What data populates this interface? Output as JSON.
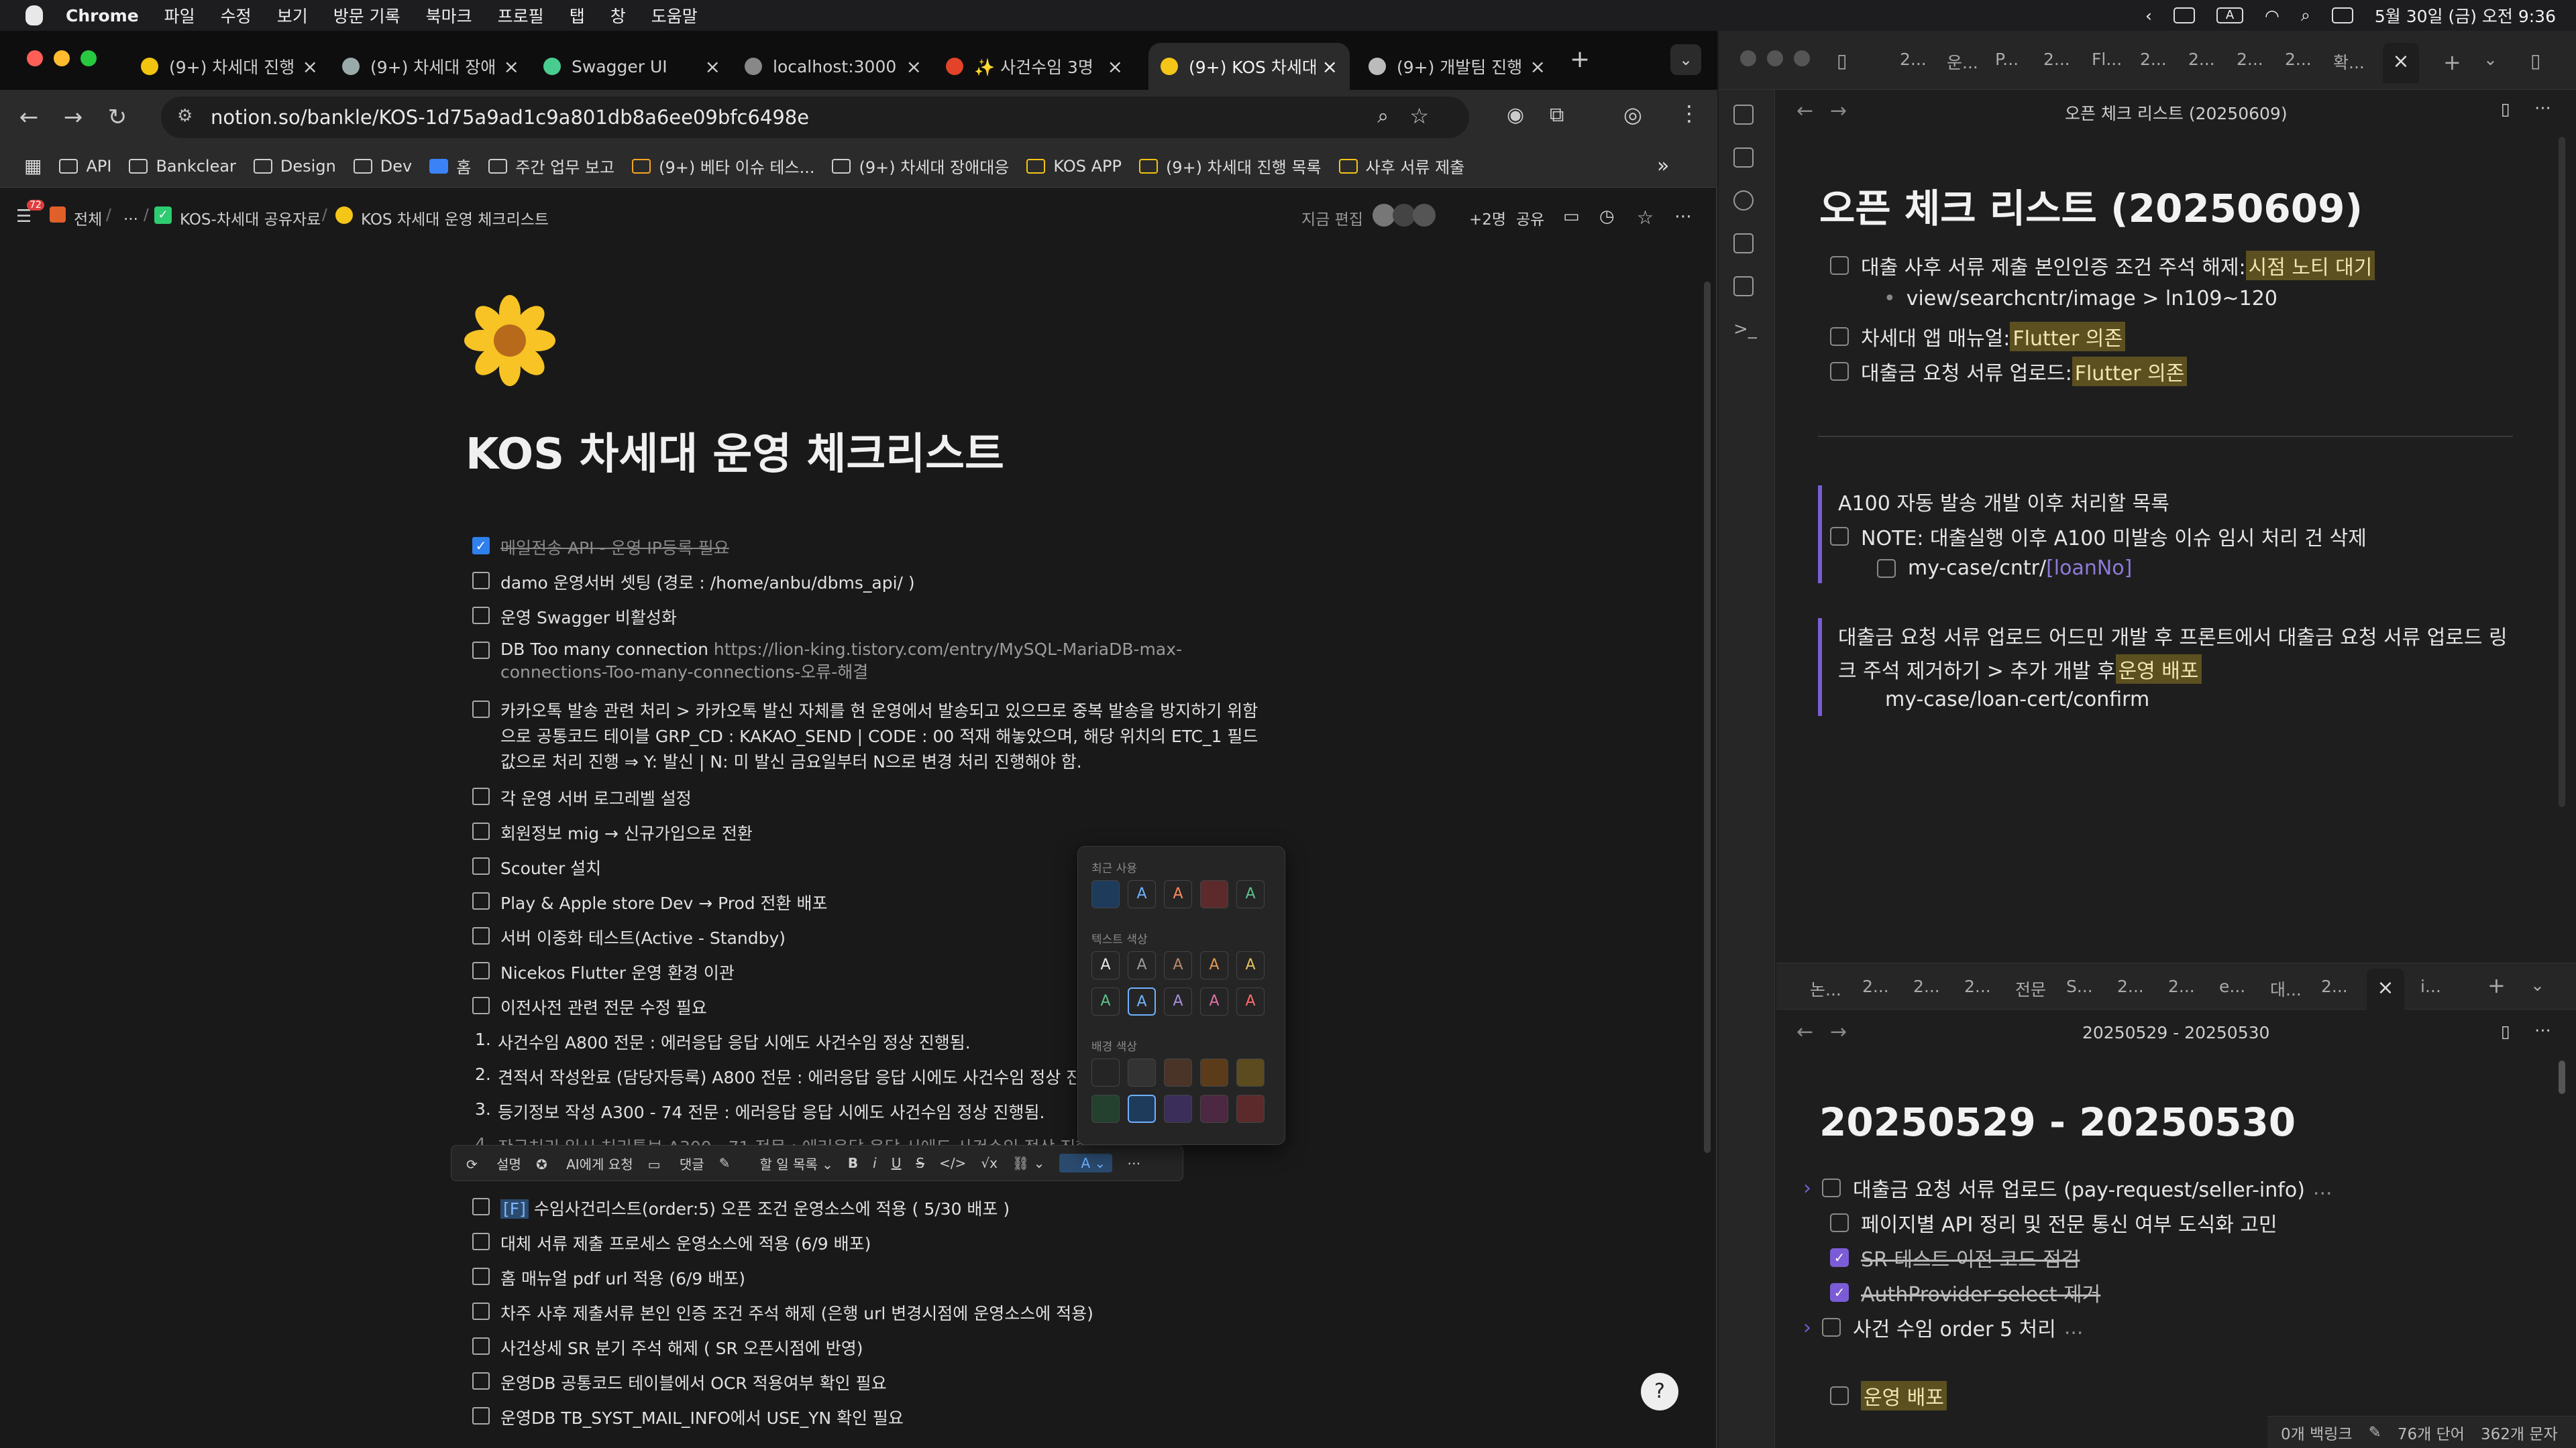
{
  "menubar": {
    "app": "Chrome",
    "items": [
      "파일",
      "수정",
      "보기",
      "방문 기록",
      "북마크",
      "프로필",
      "탭",
      "창",
      "도움말"
    ],
    "datetime": "5월 30일 (금) 오전 9:36"
  },
  "chrome": {
    "tabs": [
      {
        "label": "(9+) 차세대 진행",
        "icon_color": "#f1c40f"
      },
      {
        "label": "(9+) 차세대 장애",
        "icon_color": "#9aa"
      },
      {
        "label": "Swagger UI",
        "icon_color": "#49cc90"
      },
      {
        "label": "localhost:3000",
        "icon_color": "#888"
      },
      {
        "label": "✨ 사건수임 3명",
        "icon_color": "#e24329"
      },
      {
        "label": "(9+) KOS 차세대",
        "icon_color": "#f5c518"
      },
      {
        "label": "(9+) 개발팀 진행",
        "icon_color": "#bbb"
      }
    ],
    "url": "notion.so/bankle/KOS-1d75a9ad1c9a801db8a6ee09bfc6498e",
    "bookmarks": [
      "API",
      "Bankclear",
      "Design",
      "홈",
      "Dev",
      "주간 업무 보고",
      "(9+) 베타 이슈 테스...",
      "(9+) 차세대 장애대응",
      "KOS APP",
      "(9+) 차세대 진행 목록",
      "사후 서류 제출"
    ]
  },
  "notion": {
    "notif_count": "72",
    "breadcrumb": [
      "전체",
      "...",
      "KOS-차세대 공유자료",
      "KOS 차세대 운영 체크리스트"
    ],
    "topbar": {
      "edited": "지금 편집",
      "members": "+2명",
      "share": "공유"
    },
    "title": "KOS 차세대 운영 체크리스트",
    "items": [
      {
        "text": "메일전송 API - 운영 IP등록 필요",
        "done": true
      },
      {
        "text": "damo 운영서버 셋팅 (경로 : /home/anbu/dbms_api/ )",
        "done": false
      },
      {
        "text": "운영 Swagger 비활성화",
        "done": false
      },
      {
        "text": "DB Too many connection ",
        "link": "https://lion-king.tistory.com/entry/MySQL-MariaDB-max-",
        "link2": "connections-Too-many-connections-오류-해결",
        "done": false
      },
      {
        "text": "카카오톡 발송 관련 처리 > 카카오톡 발신 자체를 현 운영에서 발송되고 있으므로 중복 발송을 방지하기 위함",
        "line2": "으로 공통코드 테이블 GRP_CD : KAKAO_SEND | CODE : 00 적재 해놓았으며, 해당 위치의 ETC_1 필드",
        "line3": "값으로 처리 진행 ⇒ Y: 발신 | N: 미 발신 금요일부터 N으로 변경 처리 진행해야 함.",
        "done": false
      },
      {
        "text": "각 운영 서버 로그레벨 설정",
        "done": false
      },
      {
        "text": "회원정보 mig → 신규가입으로 전환",
        "done": false
      },
      {
        "text": "Scouter 설치",
        "done": false
      },
      {
        "text": "Play & Apple store Dev → Prod 전환 배포",
        "done": false
      },
      {
        "text": "서버 이중화 테스트(Active - Standby)",
        "done": false
      },
      {
        "text": "Nicekos Flutter 운영 환경 이관",
        "done": false
      },
      {
        "text": "이전사전 관련 전문 수정 필요",
        "done": false
      }
    ],
    "numbered": [
      "사건수임 A800 전문 : 에러응답 응답 시에도 사건수임 정상 진행됨.",
      "견적서 작성완료 (담당자등록) A800 전문 : 에러응답 응답 시에도 사건수임 정상 진행됨",
      "등기정보 작성 A300 - 74 전문 :  에러응답 응답 시에도 사건수임 정상 진행됨.",
      "잔금처리 일시 처리통보 A300 - 71 전문 :  에러응답 응답 시에도 사건수임 정상 진행됨."
    ],
    "items_after": [
      {
        "tag": "[F]",
        "text": " 수임사건리스트(order:5) 오픈 조건 운영소스에 적용 ( 5/30 배포 )"
      },
      {
        "text": "대체 서류 제출 프로세스 운영소스에 적용 (6/9 배포)"
      },
      {
        "text": "홈 매뉴얼 pdf url 적용 (6/9 배포)"
      },
      {
        "text": "차주 사후 제출서류 본인 인증 조건 주석 해제 (은행 url 변경시점에 운영소스에 적용)"
      },
      {
        "text": "사건상세 SR 분기 주석 해제 ( SR 오픈시점에 반영)"
      },
      {
        "text": "운영DB 공통코드 테이블에서 OCR 적용여부 확인 필요"
      },
      {
        "text": "운영DB TB_SYST_MAIL_INFO에서 USE_YN 확인 필요"
      }
    ],
    "picker": {
      "recent": "최근 사용",
      "text_color": "텍스트 색상",
      "bg_color": "배경 색상",
      "glyph": "A"
    },
    "format_toolbar": [
      "설명",
      "AI에게 요청",
      "댓글",
      "할 일 목록",
      "B",
      "i",
      "U",
      "S",
      "</>",
      "√x",
      "A",
      "⋯"
    ]
  },
  "obsidian": {
    "top_tabs": [
      "2...",
      "운...",
      "P...",
      "2...",
      "Fl...",
      "2...",
      "2...",
      "2...",
      "2...",
      "확..."
    ],
    "pane1": {
      "header": "오픈 체크 리스트 (20250609)",
      "title": "오픈 체크 리스트 (20250609)",
      "items": [
        {
          "text": "대출 사후 서류 제출 본인인증 조건 주석 해제: ",
          "hl": "시점 노티 대기"
        },
        {
          "bullet": "view/searchcntr/image > ln109~120"
        },
        {
          "text": "차세대 앱 매뉴얼: ",
          "hl": "Flutter 의존"
        },
        {
          "text": "대출금 요청 서류 업로드: ",
          "hl": "Flutter 의존"
        }
      ],
      "quote1_title": "A100 자동 발송 개발 이후 처리할 목록",
      "quote1_item": "NOTE: 대출실행 이후 A100 미발송 이슈 임시 처리 건 삭제",
      "quote1_sub": "my-case/cntr/",
      "quote1_sub_link": "[loanNo]",
      "quote2_line1": "대출금 요청 서류 업로드 어드민 개발 후 프론트에서 대출금 요청 서류 업로드 링",
      "quote2_line2": "크 주석 제거하기 > 추가 개발 후 ",
      "quote2_hl": "운영 배포",
      "quote2_sub": "my-case/loan-cert/confirm"
    },
    "mid_tabs": [
      "논...",
      "2...",
      "2...",
      "2...",
      "전문",
      "S...",
      "2...",
      "2...",
      "e...",
      "대...",
      "2...",
      "i..."
    ],
    "pane2": {
      "header": "20250529 - 20250530",
      "title": "20250529 - 20250530",
      "items": [
        {
          "text": "대출금 요청 서류 업로드 (pay-request/seller-info)",
          "suffix": "...",
          "done": false,
          "arrow": true
        },
        {
          "text": "페이지별 API 정리 및 전문 통신 여부 도식화 고민",
          "done": false
        },
        {
          "text": "SR 테스트 이전 코드 점검",
          "done": true
        },
        {
          "text": "AuthProvider select 제거",
          "done": true
        },
        {
          "text": "사건 수임 order 5 처리",
          "suffix": "...",
          "done": false,
          "arrow": true
        },
        {
          "hl": "운영 배포",
          "done": false
        }
      ]
    },
    "status": {
      "backlinks": "0개 백링크",
      "words": "76개 단어",
      "chars": "362개 문자"
    }
  }
}
